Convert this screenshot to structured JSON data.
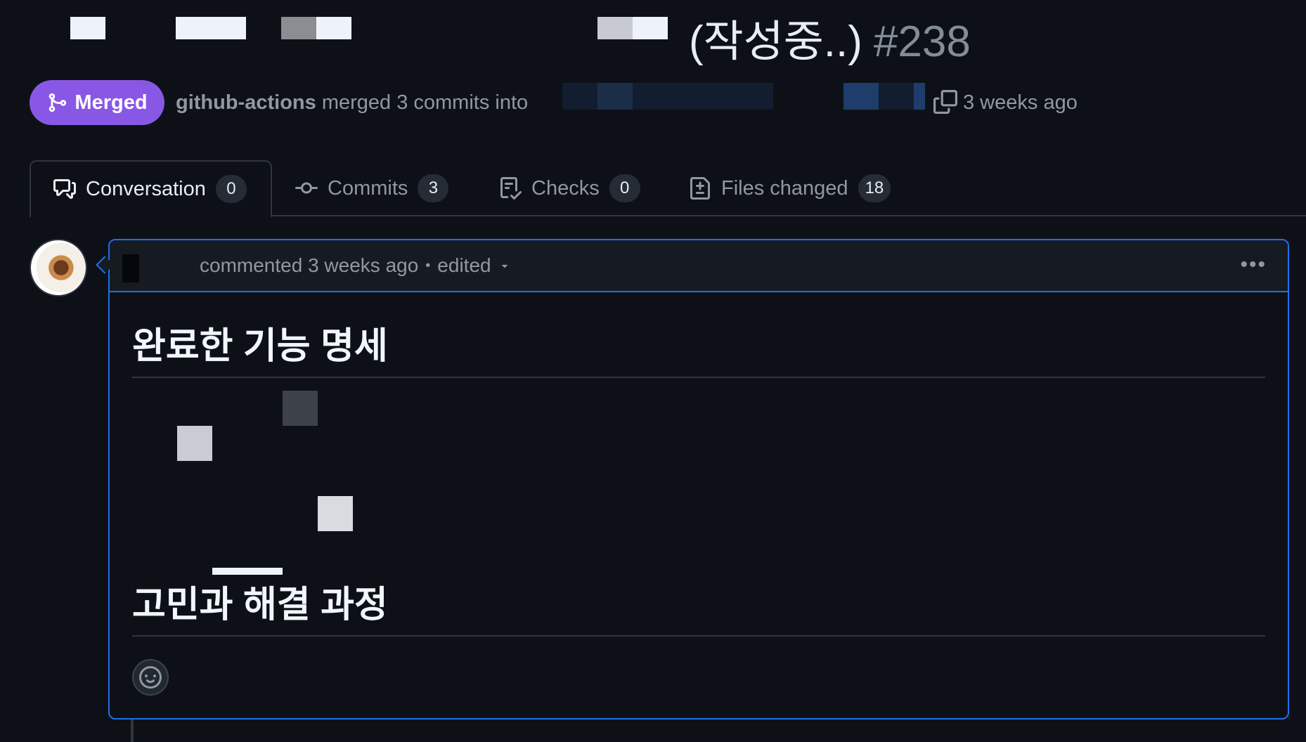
{
  "pr": {
    "title": "(작성중..)",
    "number": "#238",
    "status": "Merged",
    "merged_by": "github-actions",
    "merge_text": "merged 3 commits into",
    "time": "3 weeks ago"
  },
  "tabs": [
    {
      "label": "Conversation",
      "count": "0",
      "icon": "comment-discussion-icon"
    },
    {
      "label": "Commits",
      "count": "3",
      "icon": "commit-icon"
    },
    {
      "label": "Checks",
      "count": "0",
      "icon": "checklist-icon"
    },
    {
      "label": "Files changed",
      "count": "18",
      "icon": "file-diff-icon"
    }
  ],
  "comment": {
    "meta": "commented 3 weeks ago",
    "separator": "•",
    "edited": "edited",
    "more": "•••",
    "headings": [
      "완료한 기능 명세",
      "고민과 해결 과정"
    ]
  },
  "colors": {
    "background": "#0d1117",
    "merged_badge": "#8957e5",
    "comment_border": "#1f6feb",
    "muted_text": "#9198a1"
  }
}
